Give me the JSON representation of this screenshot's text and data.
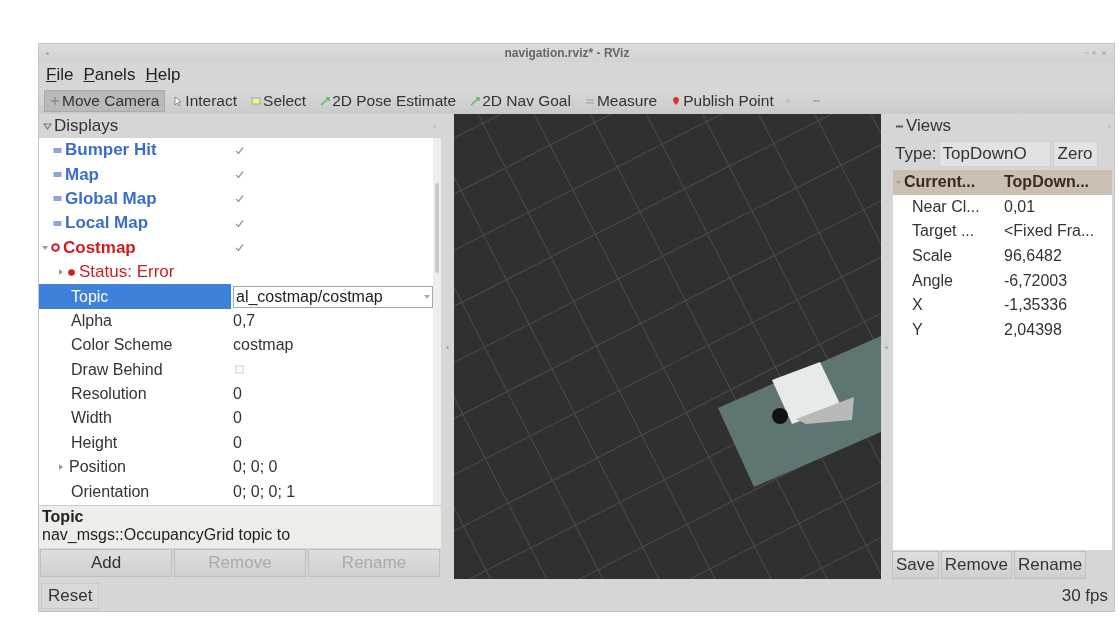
{
  "window": {
    "title": "navigation.rviz* - RViz"
  },
  "menu": [
    "File",
    "Panels",
    "Help"
  ],
  "toolbar": [
    {
      "label": "Move Camera",
      "kind": "move",
      "selected": true
    },
    {
      "label": "Interact",
      "kind": "interact",
      "selected": false
    },
    {
      "label": "Select",
      "kind": "select",
      "selected": false
    },
    {
      "label": "2D Pose Estimate",
      "kind": "pose",
      "selected": false
    },
    {
      "label": "2D Nav Goal",
      "kind": "goal",
      "selected": false
    },
    {
      "label": "Measure",
      "kind": "measure",
      "selected": false
    },
    {
      "label": "Publish Point",
      "kind": "point",
      "selected": false
    }
  ],
  "displays": {
    "title": "Displays",
    "items": [
      {
        "label": "Bumper Hit",
        "kind": "display",
        "error": false,
        "checked": true,
        "selected": false
      },
      {
        "label": "Map",
        "kind": "display",
        "error": false,
        "checked": true,
        "selected": false
      },
      {
        "label": "Global Map",
        "kind": "display",
        "error": false,
        "checked": true,
        "selected": false
      },
      {
        "label": "Local Map",
        "kind": "display",
        "error": false,
        "checked": true,
        "selected": false
      },
      {
        "label": "Costmap",
        "kind": "display",
        "error": true,
        "checked": true,
        "selected": false,
        "expanded": true,
        "children": [
          {
            "label": "Status: Error",
            "kind": "status",
            "error": true,
            "selected": false,
            "expanded": false
          },
          {
            "label": "Topic",
            "kind": "combo",
            "value": "al_costmap/costmap",
            "selected": true
          },
          {
            "label": "Alpha",
            "kind": "property",
            "value": "0,7",
            "selected": false
          },
          {
            "label": "Color Scheme",
            "kind": "property",
            "value": "costmap",
            "selected": false
          },
          {
            "label": "Draw Behind",
            "kind": "checkbox",
            "checked": false,
            "selected": false
          },
          {
            "label": "Resolution",
            "kind": "property",
            "value": "0",
            "selected": false
          },
          {
            "label": "Width",
            "kind": "property",
            "value": "0",
            "selected": false
          },
          {
            "label": "Height",
            "kind": "property",
            "value": "0",
            "selected": false
          },
          {
            "label": "Position",
            "kind": "property",
            "value": "0; 0; 0",
            "selected": false,
            "expanded": false
          },
          {
            "label": "Orientation",
            "kind": "property",
            "value": "0; 0; 0; 1",
            "selected": false
          }
        ]
      }
    ],
    "description": {
      "title": "Topic",
      "text": "nav_msgs::OccupancyGrid topic to"
    },
    "buttons": [
      {
        "label": "Add",
        "disabled": false
      },
      {
        "label": "Remove",
        "disabled": true
      },
      {
        "label": "Rename",
        "disabled": true
      }
    ]
  },
  "views": {
    "title": "Views",
    "type_label": "Type:",
    "type_value": "TopDownO",
    "zero_button": "Zero",
    "rows": [
      {
        "name": "Current...",
        "value": "TopDown...",
        "selected": true,
        "expanded": true,
        "children": [
          {
            "name": "Near Cl...",
            "value": "0,01",
            "selected": false
          },
          {
            "name": "Target ...",
            "value": "<Fixed Fra...",
            "selected": false
          },
          {
            "name": "Scale",
            "value": "96,6482",
            "selected": false
          },
          {
            "name": "Angle",
            "value": "-6,72003",
            "selected": false
          },
          {
            "name": "X",
            "value": "-1,35336",
            "selected": false
          },
          {
            "name": "Y",
            "value": "2,04398",
            "selected": false
          }
        ]
      }
    ],
    "buttons": [
      "Save",
      "Remove",
      "Rename"
    ]
  },
  "status_bar": {
    "reset_button": "Reset",
    "fps": "30 fps"
  }
}
